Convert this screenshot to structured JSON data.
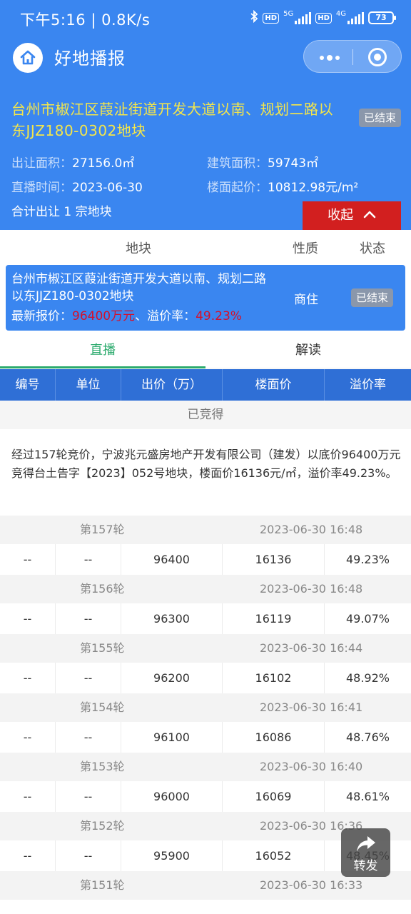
{
  "status_bar": {
    "time": "下午5:16 | 0.8K/s",
    "hd1": "HD",
    "net1": "5G",
    "hd2": "HD",
    "net2": "4G",
    "battery": "73"
  },
  "nav": {
    "title": "好地播报"
  },
  "info": {
    "title": "台州市椒江区葭沚街道开发大道以南、规划二路以东JJZ180-0302地块",
    "status": "已结束",
    "area_label": "出让面积：",
    "area_value": "27156.0㎡",
    "build_label": "建筑面积：",
    "build_value": "59743㎡",
    "time_label": "直播时间：",
    "time_value": "2023-06-30",
    "floor_label": "楼面起价：",
    "floor_value": "10812.98元/m²",
    "total": "合计出让 1 宗地块",
    "collapse_label": "收起"
  },
  "parcel_list": {
    "headers": [
      "地块",
      "性质",
      "状态"
    ],
    "item": {
      "name": "台州市椒江区葭沚街道开发大道以南、规划二路以东JJZ180-0302地块",
      "price_label": "最新报价：",
      "price_value": "96400万元",
      "premium_label": "、溢价率：",
      "premium_value": "49.23%",
      "type": "商住",
      "status": "已结束"
    }
  },
  "tabs": [
    "直播",
    "解读"
  ],
  "bid_table": {
    "headers": [
      "编号",
      "单位",
      "出价（万）",
      "楼面价",
      "溢价率"
    ],
    "won_label": "已竞得",
    "summary": "经过157轮竞价，宁波兆元盛房地产开发有限公司（建发）以底价96400万元竞得台土告字【2023】052号地块，楼面价16136元/㎡，溢价率49.23%。",
    "rounds": [
      {
        "round": "第157轮",
        "time": "2023-06-30 16:48",
        "no": "--",
        "unit": "--",
        "price": "96400",
        "floor": "16136",
        "premium": "49.23%"
      },
      {
        "round": "第156轮",
        "time": "2023-06-30 16:48",
        "no": "--",
        "unit": "--",
        "price": "96300",
        "floor": "16119",
        "premium": "49.07%"
      },
      {
        "round": "第155轮",
        "time": "2023-06-30 16:44",
        "no": "--",
        "unit": "--",
        "price": "96200",
        "floor": "16102",
        "premium": "48.92%"
      },
      {
        "round": "第154轮",
        "time": "2023-06-30 16:41",
        "no": "--",
        "unit": "--",
        "price": "96100",
        "floor": "16086",
        "premium": "48.76%"
      },
      {
        "round": "第153轮",
        "time": "2023-06-30 16:40",
        "no": "--",
        "unit": "--",
        "price": "96000",
        "floor": "16069",
        "premium": "48.61%"
      },
      {
        "round": "第152轮",
        "time": "2023-06-30 16:36",
        "no": "--",
        "unit": "--",
        "price": "95900",
        "floor": "16052",
        "premium": "48.45%"
      },
      {
        "round": "第151轮",
        "time": "2023-06-30 16:33"
      }
    ]
  },
  "share": {
    "label": "转发"
  }
}
